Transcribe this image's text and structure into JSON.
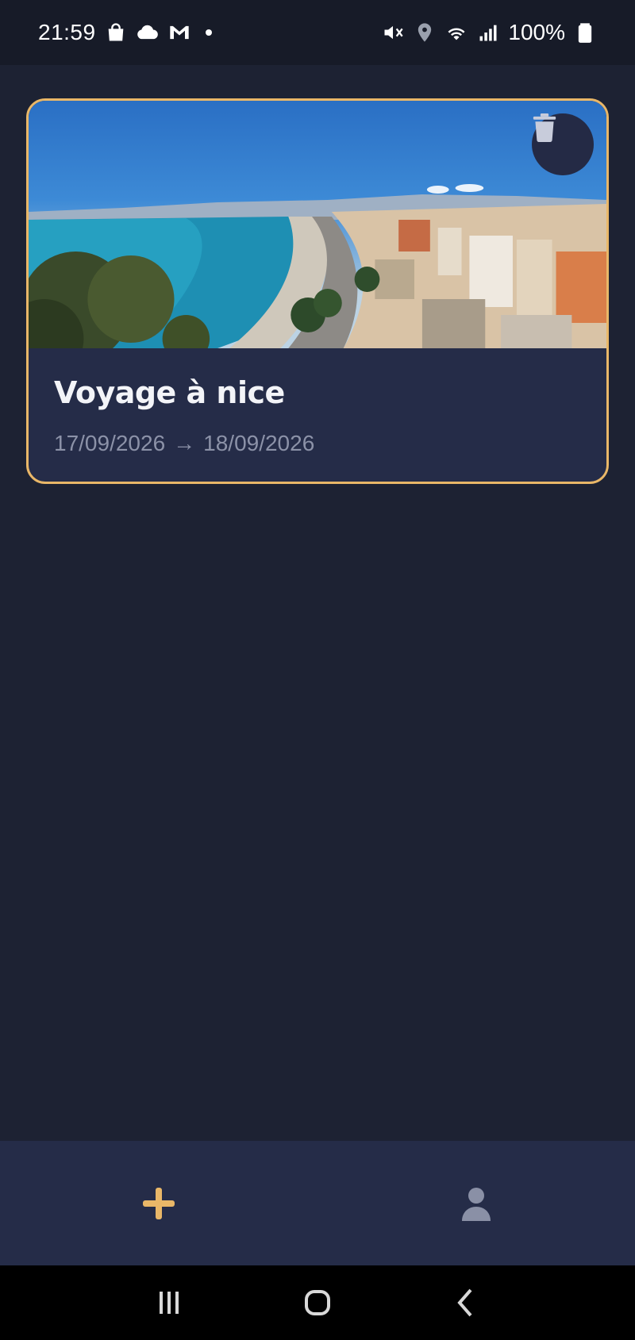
{
  "status_bar": {
    "time": "21:59",
    "battery": "100%",
    "left_icons": [
      "shopping-bag-icon",
      "cloud-icon",
      "gmail-icon",
      "dot-icon"
    ],
    "right_icons": [
      "mute-icon",
      "location-icon",
      "wifi-icon",
      "signal-icon",
      "battery-icon"
    ]
  },
  "trips": [
    {
      "title": "Voyage à nice",
      "start_date": "17/09/2026",
      "arrow": "→",
      "end_date": "18/09/2026"
    }
  ],
  "bottom_nav": {
    "items": [
      "add-icon",
      "profile-icon"
    ]
  },
  "colors": {
    "background": "#1d2233",
    "card": "#252c48",
    "accent": "#e9b768",
    "muted_text": "#8c92a8"
  }
}
